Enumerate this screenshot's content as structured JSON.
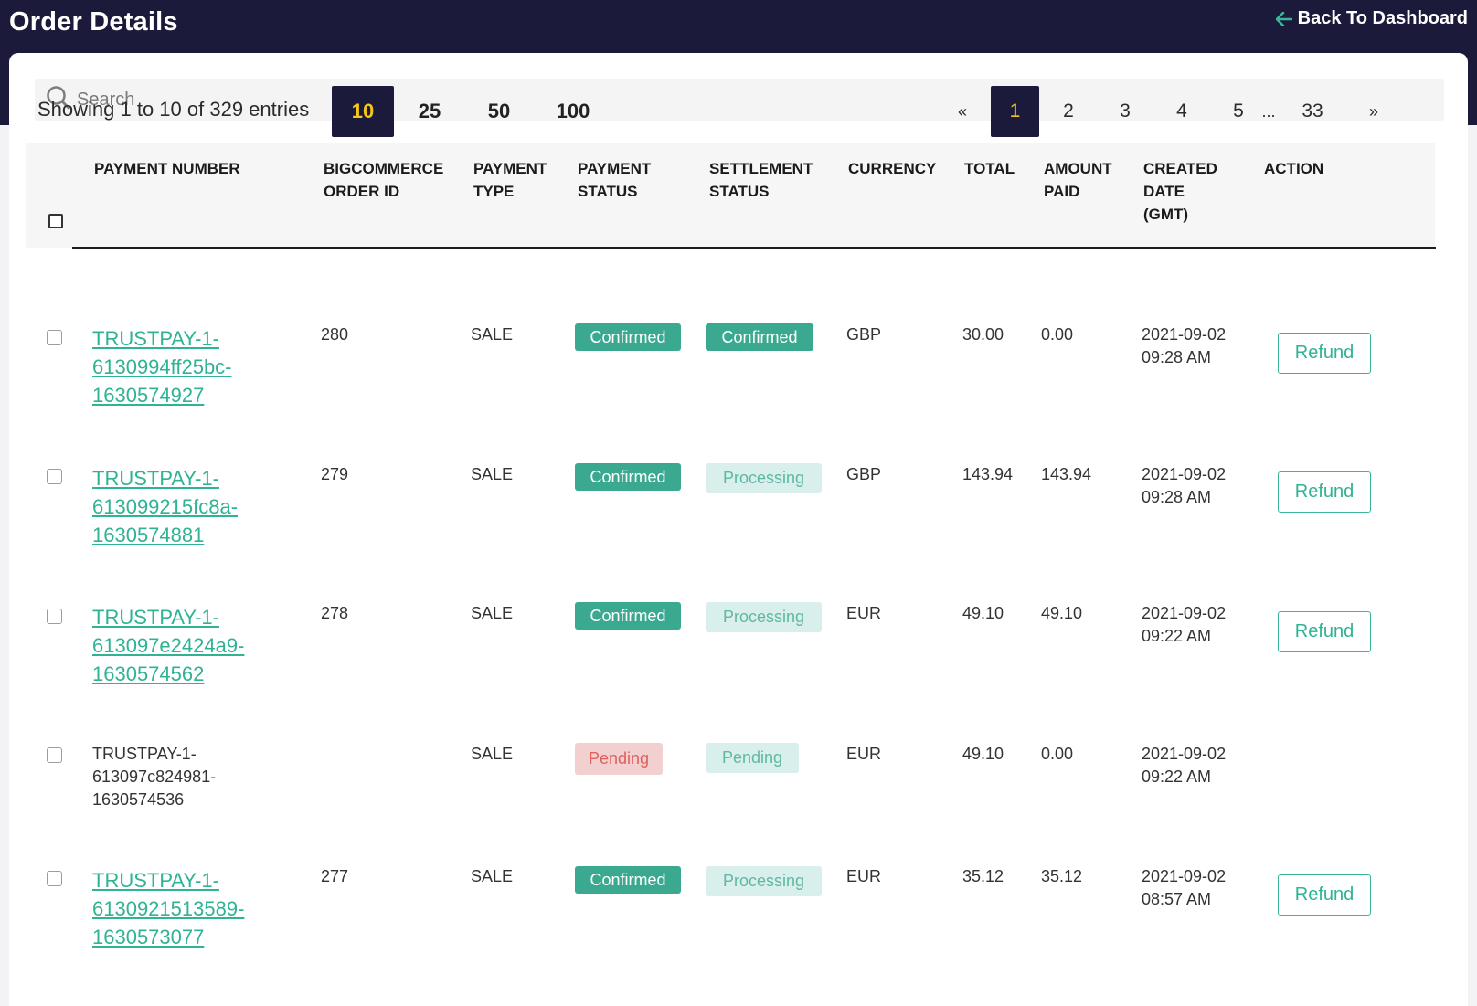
{
  "header": {
    "title": "Order Details",
    "back_label": "Back To Dashboard"
  },
  "search": {
    "placeholder": "Search"
  },
  "info": {
    "showing": "Showing 1 to 10 of 329 entries"
  },
  "page_sizes": [
    "10",
    "25",
    "50",
    "100"
  ],
  "pagination": {
    "prev": "«",
    "next": "»",
    "ellipsis": "...",
    "pages": [
      "1",
      "2",
      "3",
      "4",
      "5",
      "33"
    ]
  },
  "columns": {
    "payment_number": "PAYMENT NUMBER",
    "bigcommerce_order_id": "BIGCOMMERCE\nORDER ID",
    "payment_type": "PAYMENT\nTYPE",
    "payment_status": "PAYMENT\nSTATUS",
    "settlement_status": "SETTLEMENT\nSTATUS",
    "currency": "CURRENCY",
    "total": "TOTAL",
    "amount_paid": "AMOUNT\nPAID",
    "created_date": "CREATED\nDATE\n(GMT)",
    "action": "ACTION"
  },
  "rows": [
    {
      "payment_number": "TRUSTPAY-1-\n6130994ff25bc-\n1630574927",
      "order_id": "280",
      "type": "SALE",
      "payment_status": "Confirmed",
      "settlement_status": "Confirmed",
      "currency": "GBP",
      "total": "30.00",
      "amount_paid": "0.00",
      "created": "2021-09-02\n09:28 AM",
      "action": "Refund"
    },
    {
      "payment_number": "TRUSTPAY-1-\n613099215fc8a-\n1630574881",
      "order_id": "279",
      "type": "SALE",
      "payment_status": "Confirmed",
      "settlement_status": "Processing",
      "currency": "GBP",
      "total": "143.94",
      "amount_paid": "143.94",
      "created": "2021-09-02\n09:28 AM",
      "action": "Refund"
    },
    {
      "payment_number": "TRUSTPAY-1-\n613097e2424a9-\n1630574562",
      "order_id": "278",
      "type": "SALE",
      "payment_status": "Confirmed",
      "settlement_status": "Processing",
      "currency": "EUR",
      "total": "49.10",
      "amount_paid": "49.10",
      "created": "2021-09-02\n09:22 AM",
      "action": "Refund"
    },
    {
      "payment_number": "TRUSTPAY-1-\n613097c824981-\n1630574536",
      "order_id": "",
      "type": "SALE",
      "payment_status": "Pending",
      "settlement_status": "Pending",
      "currency": "EUR",
      "total": "49.10",
      "amount_paid": "0.00",
      "created": "2021-09-02\n09:22 AM",
      "action": ""
    },
    {
      "payment_number": "TRUSTPAY-1-\n6130921513589-\n1630573077",
      "order_id": "277",
      "type": "SALE",
      "payment_status": "Confirmed",
      "settlement_status": "Processing",
      "currency": "EUR",
      "total": "35.12",
      "amount_paid": "35.12",
      "created": "2021-09-02\n08:57 AM",
      "action": "Refund"
    }
  ],
  "colors": {
    "header_bg": "#1c1a3a",
    "accent": "#3bb59a",
    "active_page_text": "#f5c518",
    "pending_red": "#e05f5f"
  },
  "icons": {
    "back": "arrow-left-icon",
    "search": "search-icon"
  }
}
